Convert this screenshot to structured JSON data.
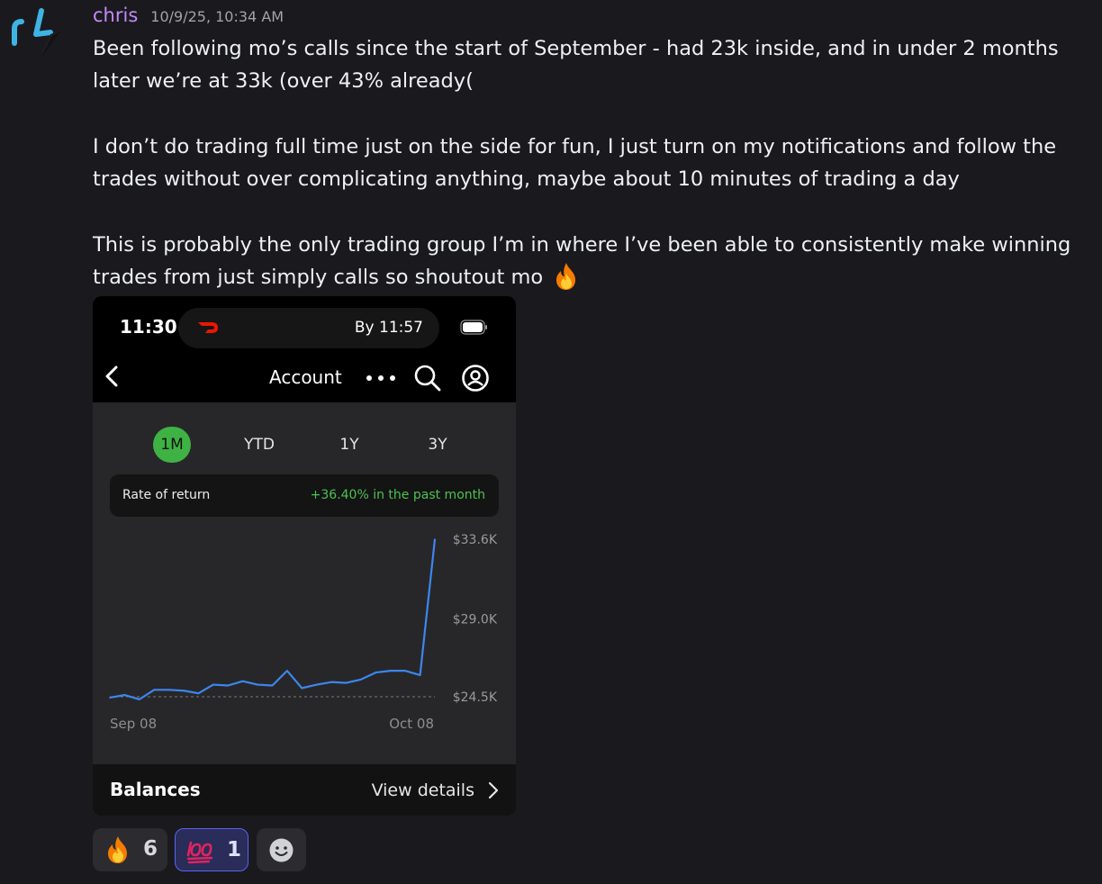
{
  "message": {
    "author": "chris",
    "timestamp": "10/9/25, 10:34 AM",
    "paragraphs": [
      "Been following mo’s calls since the start of September - had 23k inside, and in under 2 months later we’re at 33k (over 43% already(",
      "I don’t do trading full time just on the side for fun, I just turn on my notifications and follow the trades without over complicating anything, maybe about 10 minutes of trading a day",
      "This is probably the only trading group I’m in where I’ve been able to consistently make winning trades from just simply calls so shoutout mo"
    ],
    "inline_emoji": "fire-icon",
    "author_color": "#c58af9"
  },
  "screenshot": {
    "status": {
      "time": "11:30",
      "island_text": "By 11:57"
    },
    "nav": {
      "title": "Account"
    },
    "ranges": [
      "1M",
      "YTD",
      "1Y",
      "3Y"
    ],
    "active_range": "1M",
    "rate_of_return": {
      "label": "Rate of return",
      "value": "+36.40% in the past month"
    },
    "balances": {
      "label": "Balances",
      "link": "View details"
    },
    "accent_green": "#3fb244",
    "line_color": "#3d86ee"
  },
  "chart_data": {
    "type": "line",
    "x_labels": [
      "Sep 08",
      "Oct 08"
    ],
    "y_ticks": [
      "$33.6K",
      "$29.0K",
      "$24.5K"
    ],
    "ylim": [
      24.0,
      34.0
    ],
    "baseline": 24.5,
    "series": [
      {
        "values": [
          24.45,
          24.6,
          24.35,
          24.9,
          24.9,
          24.85,
          24.7,
          25.2,
          25.15,
          25.4,
          25.2,
          25.15,
          26.0,
          25.0,
          25.2,
          25.35,
          25.3,
          25.5,
          25.9,
          26.0,
          26.0,
          25.75,
          33.6
        ]
      }
    ]
  },
  "reactions": [
    {
      "emoji": "fire-icon",
      "count": "6"
    },
    {
      "emoji": "hundred-points-icon",
      "count": "1"
    },
    {
      "emoji": "add-reaction-icon"
    }
  ]
}
